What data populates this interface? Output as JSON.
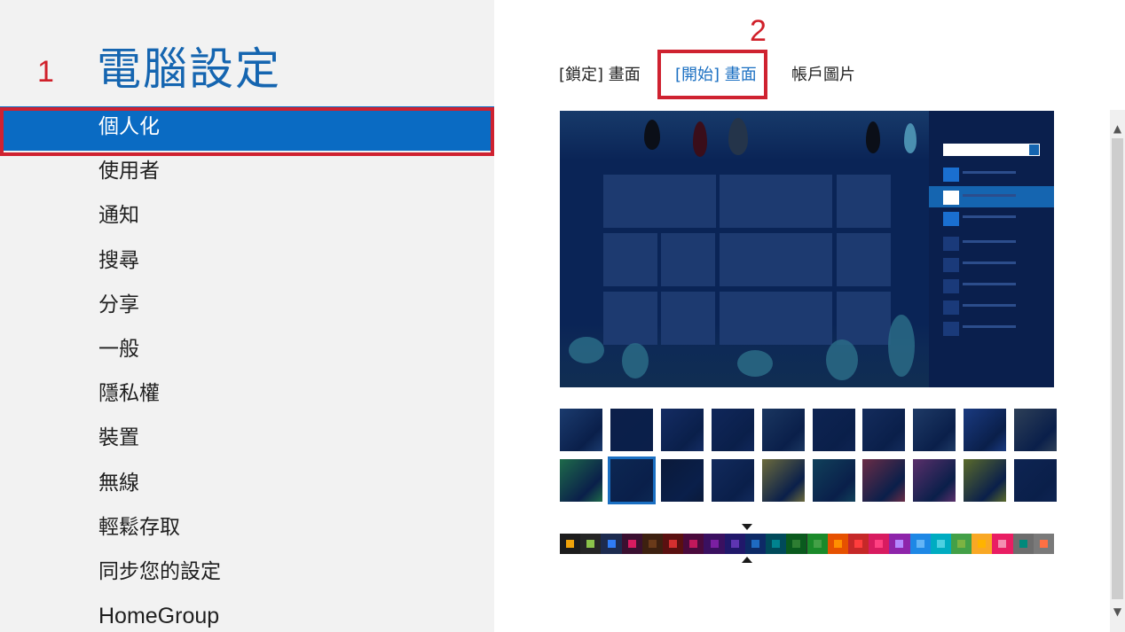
{
  "header": {
    "title": "電腦設定"
  },
  "annotations": {
    "one": "1",
    "two": "2"
  },
  "sidebar": {
    "items": [
      {
        "label": "個人化"
      },
      {
        "label": "使用者"
      },
      {
        "label": "通知"
      },
      {
        "label": "搜尋"
      },
      {
        "label": "分享"
      },
      {
        "label": "一般"
      },
      {
        "label": "隱私權"
      },
      {
        "label": "裝置"
      },
      {
        "label": "無線"
      },
      {
        "label": "輕鬆存取"
      },
      {
        "label": "同步您的設定"
      },
      {
        "label": "HomeGroup"
      }
    ],
    "selected": "個人化"
  },
  "tabs": [
    {
      "label": "[鎖定] 畫面"
    },
    {
      "label": "[開始] 畫面"
    },
    {
      "label": "帳戶圖片"
    }
  ],
  "selected_tab": "[開始] 畫面",
  "colors": {
    "accent": "#1565b0",
    "selected_item": "#0a6bc3",
    "annotation_red": "#cf2230",
    "preview_background": "#0a2456"
  },
  "background_thumbnails": {
    "selected_index": 11,
    "tints": [
      "#1b3b6e",
      "#0c1f4a",
      "#142c63",
      "#10275a",
      "#1a3660",
      "#0e2452",
      "#142c5c",
      "#1e3a66",
      "#1a3a80",
      "#2d3f57",
      "#1e6a4a",
      "#0c2752",
      "#0b1a3a",
      "#122a5c",
      "#6b6a3c",
      "#10405a",
      "#6a2c46",
      "#5a2f6a",
      "#5a6a2a",
      "#0e2452"
    ]
  },
  "color_strip": {
    "selected_index": 9,
    "swatches": [
      {
        "bg": "#1c1c1c",
        "dot": "#f0a30a"
      },
      {
        "bg": "#252525",
        "dot": "#8bc34a"
      },
      {
        "bg": "#1d2b4f",
        "dot": "#2f7cf6"
      },
      {
        "bg": "#3a1030",
        "dot": "#d81b60"
      },
      {
        "bg": "#3d2010",
        "dot": "#6a3a1a"
      },
      {
        "bg": "#5a1010",
        "dot": "#d32f2f"
      },
      {
        "bg": "#4a0a3c",
        "dot": "#c2185b"
      },
      {
        "bg": "#3a1060",
        "dot": "#7b1fa2"
      },
      {
        "bg": "#20186a",
        "dot": "#5e35b1"
      },
      {
        "bg": "#0d2a66",
        "dot": "#1e6ac2"
      },
      {
        "bg": "#004a5a",
        "dot": "#00838f"
      },
      {
        "bg": "#0a5a1e",
        "dot": "#2e7d32"
      },
      {
        "bg": "#1a8a2a",
        "dot": "#43a047"
      },
      {
        "bg": "#e65100",
        "dot": "#ff8f00"
      },
      {
        "bg": "#c62828",
        "dot": "#ff3d3d"
      },
      {
        "bg": "#d81b60",
        "dot": "#ff4081"
      },
      {
        "bg": "#8e24aa",
        "dot": "#b388ff"
      },
      {
        "bg": "#1e88e5",
        "dot": "#64b5f6"
      },
      {
        "bg": "#00acc1",
        "dot": "#4dd0e1"
      },
      {
        "bg": "#43a047",
        "dot": "#7cb342"
      },
      {
        "bg": "#f9a825",
        "dot": "#ffb300"
      },
      {
        "bg": "#e91e63",
        "dot": "#f48fb1"
      },
      {
        "bg": "#6d6d6d",
        "dot": "#00897b"
      },
      {
        "bg": "#7a7a7a",
        "dot": "#ff7043"
      }
    ]
  },
  "icons": {
    "scroll_up": "▲",
    "scroll_down": "▼"
  }
}
